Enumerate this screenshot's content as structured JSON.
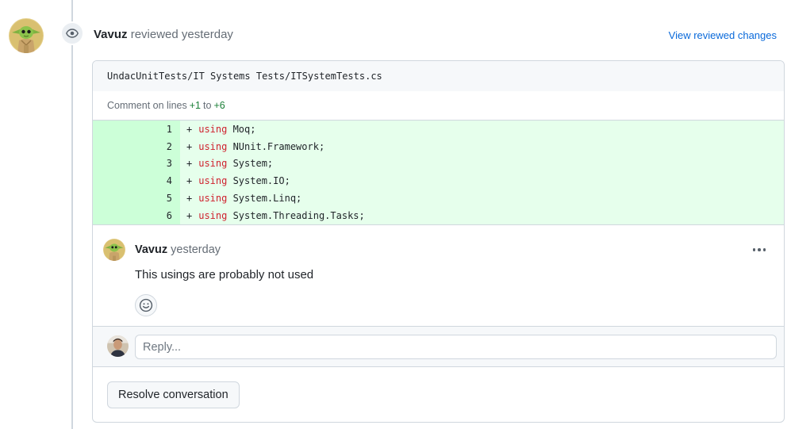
{
  "review": {
    "author": "Vavuz",
    "action": "reviewed yesterday",
    "view_reviewed_changes": "View reviewed changes"
  },
  "file": {
    "path": "UndacUnitTests/IT Systems Tests/ITSystemTests.cs"
  },
  "comment_range": {
    "prefix": "Comment on lines",
    "start": "+1",
    "connector": "to",
    "end": "+6"
  },
  "diff_lines": [
    {
      "num": "1",
      "sign": "+",
      "keyword": "using",
      "rest": " Moq;"
    },
    {
      "num": "2",
      "sign": "+",
      "keyword": "using",
      "rest": " NUnit.Framework;"
    },
    {
      "num": "3",
      "sign": "+",
      "keyword": "using",
      "rest": " System;"
    },
    {
      "num": "4",
      "sign": "+",
      "keyword": "using",
      "rest": " System.IO;"
    },
    {
      "num": "5",
      "sign": "+",
      "keyword": "using",
      "rest": " System.Linq;"
    },
    {
      "num": "6",
      "sign": "+",
      "keyword": "using",
      "rest": " System.Threading.Tasks;"
    }
  ],
  "comment": {
    "author": "Vavuz",
    "time": "yesterday",
    "body": "This usings are probably not used"
  },
  "reply": {
    "placeholder": "Reply..."
  },
  "resolve_label": "Resolve conversation",
  "colors": {
    "accent_link": "#0969da",
    "diff_added_bg": "#e6ffec",
    "diff_added_gutter": "#ccffd8",
    "keyword": "#cf222e",
    "range_green": "#1a7f37"
  },
  "icons": {
    "review_badge": "eye-icon",
    "reaction": "smiley-icon",
    "menu": "kebab-horizontal-icon"
  }
}
